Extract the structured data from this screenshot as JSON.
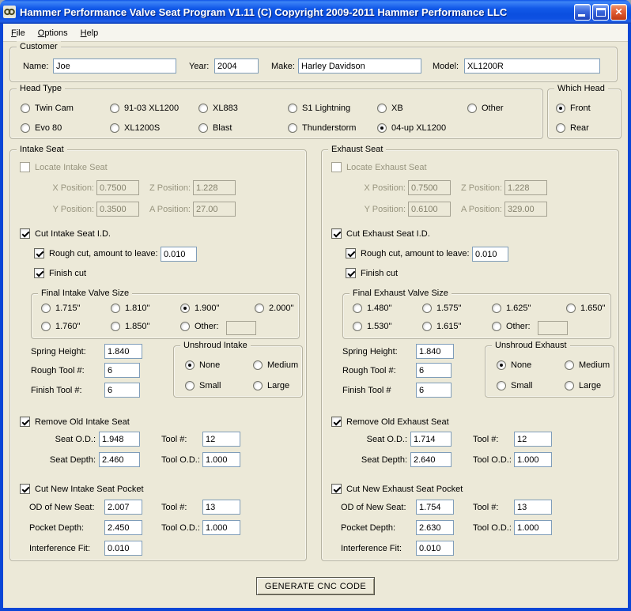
{
  "window": {
    "title": "Hammer Performance Valve Seat Program V1.11 (C) Copyright 2009-2011 Hammer Performance LLC"
  },
  "menu": {
    "file": "File",
    "options": "Options",
    "help": "Help"
  },
  "customer": {
    "title": "Customer",
    "name_label": "Name:",
    "name": "Joe",
    "year_label": "Year:",
    "year": "2004",
    "make_label": "Make:",
    "make": "Harley Davidson",
    "model_label": "Model:",
    "model": "XL1200R"
  },
  "head_type": {
    "title": "Head Type",
    "options": [
      "Twin Cam",
      "91-03 XL1200",
      "XL883",
      "S1 Lightning",
      "XB",
      "Other",
      "Evo 80",
      "XL1200S",
      "Blast",
      "Thunderstorm",
      "04-up XL1200"
    ],
    "selected": "04-up XL1200"
  },
  "which_head": {
    "title": "Which Head",
    "options": [
      "Front",
      "Rear"
    ],
    "selected": "Front"
  },
  "intake": {
    "title": "Intake Seat",
    "locate_label": "Locate Intake Seat",
    "x_label": "X Position:",
    "x_value": "0.7500",
    "z_label": "Z Position:",
    "z_value": "1.228",
    "y_label": "Y Position:",
    "y_value": "0.3500",
    "a_label": "A Position:",
    "a_value": "27.00",
    "cut_id_label": "Cut Intake Seat I.D.",
    "rough_label": "Rough cut, amount to leave:",
    "rough_value": "0.010",
    "finish_label": "Finish cut",
    "valve_size_title": "Final Intake Valve Size",
    "valve_sizes": [
      "1.715\"",
      "1.810\"",
      "1.900\"",
      "2.000\"",
      "1.760\"",
      "1.850\"",
      "Other:"
    ],
    "valve_size_selected": "1.900\"",
    "other_value": "",
    "spring_label": "Spring Height:",
    "spring_value": "1.840",
    "rough_tool_label": "Rough Tool #:",
    "rough_tool_value": "6",
    "finish_tool_label": "Finish Tool #:",
    "finish_tool_value": "6",
    "unshroud_title": "Unshroud Intake",
    "unshroud_options": [
      "None",
      "Medium",
      "Small",
      "Large"
    ],
    "unshroud_selected": "None",
    "remove_label": "Remove Old Intake Seat",
    "seat_od_label": "Seat O.D.:",
    "seat_od_value": "1.948",
    "remove_tool_label": "Tool #:",
    "remove_tool_value": "12",
    "seat_depth_label": "Seat Depth:",
    "seat_depth_value": "2.460",
    "remove_tool_od_label": "Tool O.D.:",
    "remove_tool_od_value": "1.000",
    "pocket_label": "Cut New Intake Seat Pocket",
    "od_new_label": "OD of New Seat:",
    "od_new_value": "2.007",
    "pocket_tool_label": "Tool #:",
    "pocket_tool_value": "13",
    "pocket_depth_label": "Pocket Depth:",
    "pocket_depth_value": "2.450",
    "pocket_tool_od_label": "Tool O.D.:",
    "pocket_tool_od_value": "1.000",
    "fit_label": "Interference Fit:",
    "fit_value": "0.010"
  },
  "exhaust": {
    "title": "Exhaust Seat",
    "locate_label": "Locate Exhaust Seat",
    "x_label": "X Position:",
    "x_value": "0.7500",
    "z_label": "Z Position:",
    "z_value": "1.228",
    "y_label": "Y Position:",
    "y_value": "0.6100",
    "a_label": "A Position:",
    "a_value": "329.00",
    "cut_id_label": "Cut Exhaust Seat I.D.",
    "rough_label": "Rough cut, amount to leave:",
    "rough_value": "0.010",
    "finish_label": "Finish cut",
    "valve_size_title": "Final Exhaust Valve Size",
    "valve_sizes": [
      "1.480\"",
      "1.575\"",
      "1.625\"",
      "1.650\"",
      "1.530\"",
      "1.615\"",
      "Other:"
    ],
    "valve_size_selected": "",
    "other_value": "",
    "spring_label": "Spring Height:",
    "spring_value": "1.840",
    "rough_tool_label": "Rough Tool #:",
    "rough_tool_value": "6",
    "finish_tool_label": "Finish Tool #",
    "finish_tool_value": "6",
    "unshroud_title": "Unshroud Exhaust",
    "unshroud_options": [
      "None",
      "Medium",
      "Small",
      "Large"
    ],
    "unshroud_selected": "None",
    "remove_label": "Remove Old Exhaust Seat",
    "seat_od_label": "Seat O.D.:",
    "seat_od_value": "1.714",
    "remove_tool_label": "Tool #:",
    "remove_tool_value": "12",
    "seat_depth_label": "Seat Depth:",
    "seat_depth_value": "2.640",
    "remove_tool_od_label": "Tool O.D.:",
    "remove_tool_od_value": "1.000",
    "pocket_label": "Cut New Exhaust Seat Pocket",
    "od_new_label": "OD of New Seat:",
    "od_new_value": "1.754",
    "pocket_tool_label": "Tool #:",
    "pocket_tool_value": "13",
    "pocket_depth_label": "Pocket Depth:",
    "pocket_depth_value": "2.630",
    "pocket_tool_od_label": "Tool O.D.:",
    "pocket_tool_od_value": "1.000",
    "fit_label": "Interference Fit:",
    "fit_value": "0.010"
  },
  "footer": {
    "generate_label": "GENERATE CNC CODE"
  }
}
